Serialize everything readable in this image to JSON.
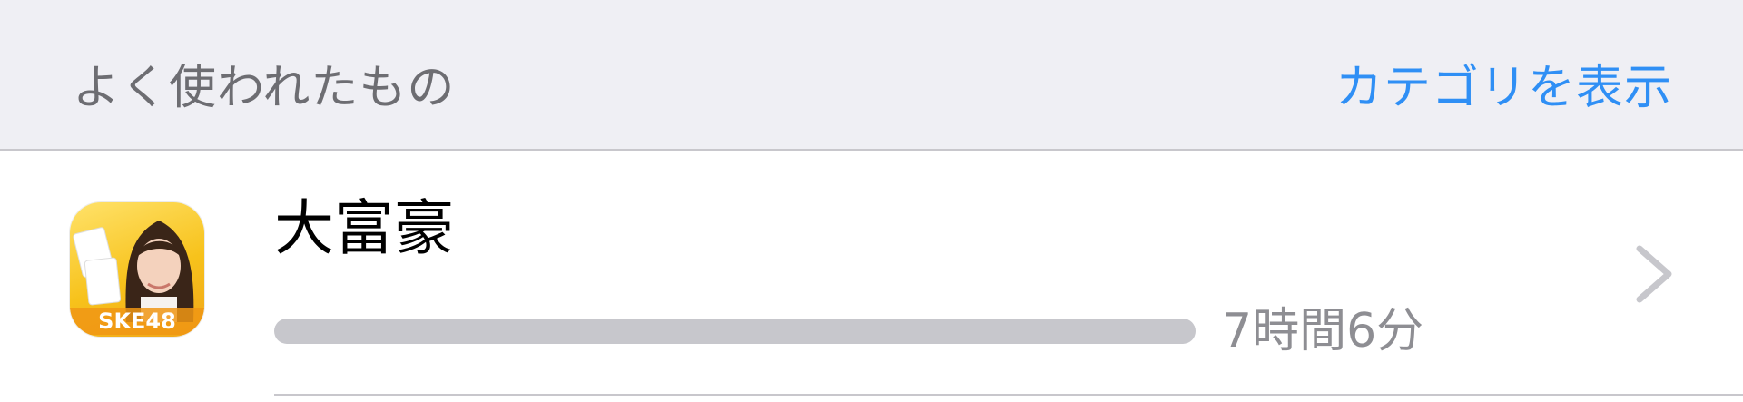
{
  "header": {
    "section_title": "よく使われたもの",
    "show_categories_label": "カテゴリを表示"
  },
  "apps": [
    {
      "name": "大富豪",
      "icon_badge": "SKE48",
      "usage_time": "7時間6分",
      "usage_fraction": 1.0
    }
  ],
  "colors": {
    "header_bg": "#efeff4",
    "link_blue": "#2f8ff5",
    "bar_gray": "#c7c7cc",
    "secondary_text": "#8e8e93"
  },
  "icons": {
    "disclosure": "chevron-right-icon"
  }
}
